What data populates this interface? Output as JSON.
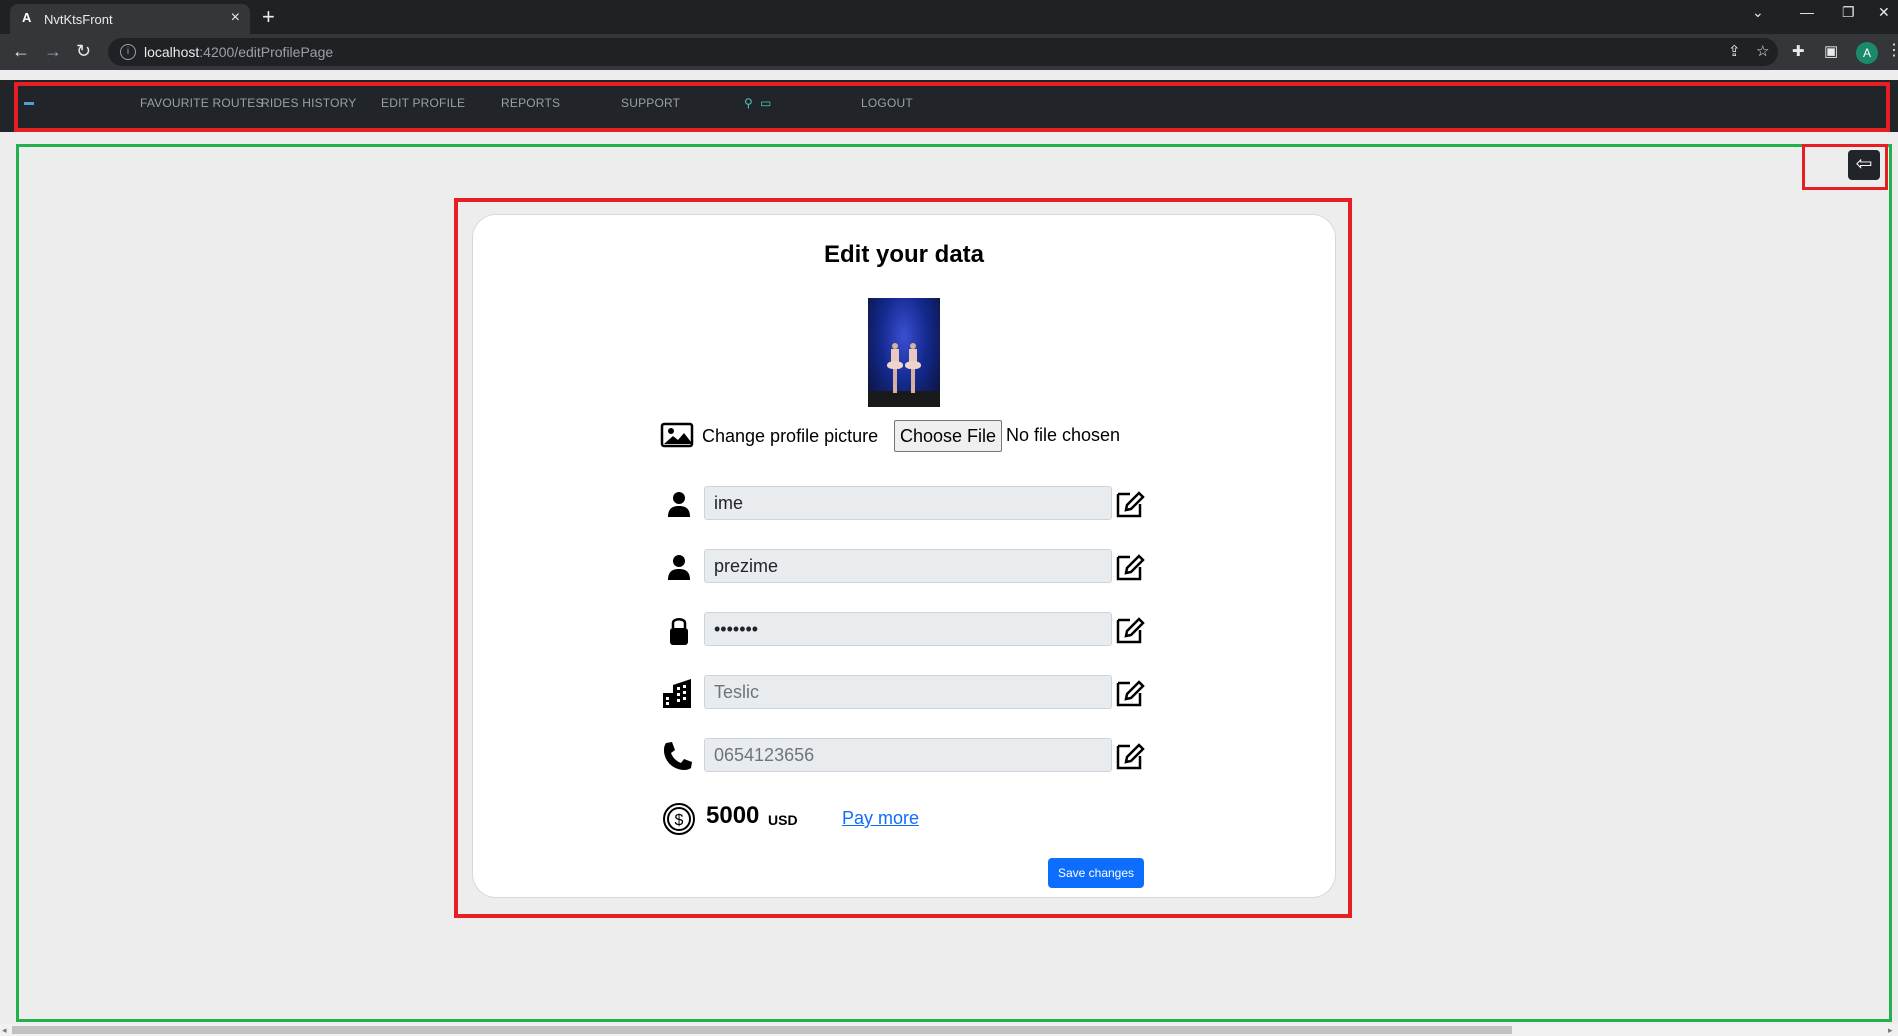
{
  "browser": {
    "tab_title": "NvtKtsFront",
    "tab_favicon": "A",
    "url_host": "localhost",
    "url_rest": ":4200/editProfilePage",
    "avatar_letter": "A"
  },
  "navbar": {
    "brand_icon": "car-icon",
    "items": [
      {
        "label": "FAVOURITE ROUTES"
      },
      {
        "label": "RIDES HISTORY"
      },
      {
        "label": "EDIT PROFILE"
      },
      {
        "label": "REPORTS"
      },
      {
        "label": "SUPPORT"
      },
      {
        "label": "LOGOUT"
      }
    ],
    "extra_icons": [
      "pin-icon",
      "screen-icon"
    ]
  },
  "back_button": {
    "icon": "arrow-left-icon"
  },
  "form": {
    "title": "Edit your data",
    "picture": {
      "label": "Change profile picture",
      "choose_file_label": "Choose File",
      "file_status": "No file chosen"
    },
    "fields": [
      {
        "icon": "person-icon",
        "value": "ime",
        "placeholder": ""
      },
      {
        "icon": "person-icon",
        "value": "prezime",
        "placeholder": ""
      },
      {
        "icon": "lock-icon",
        "value": "•••••••",
        "placeholder": ""
      },
      {
        "icon": "building-icon",
        "value": "",
        "placeholder": "Teslic"
      },
      {
        "icon": "phone-icon",
        "value": "",
        "placeholder": "0654123656"
      }
    ],
    "balance": {
      "amount": "5000",
      "currency": "USD",
      "pay_more_label": "Pay more"
    },
    "save_label": "Save changes"
  },
  "colors": {
    "navbar_bg": "#212529",
    "primary": "#0d6efd",
    "annotation_red": "#e81e25",
    "annotation_green": "#22b14c"
  }
}
